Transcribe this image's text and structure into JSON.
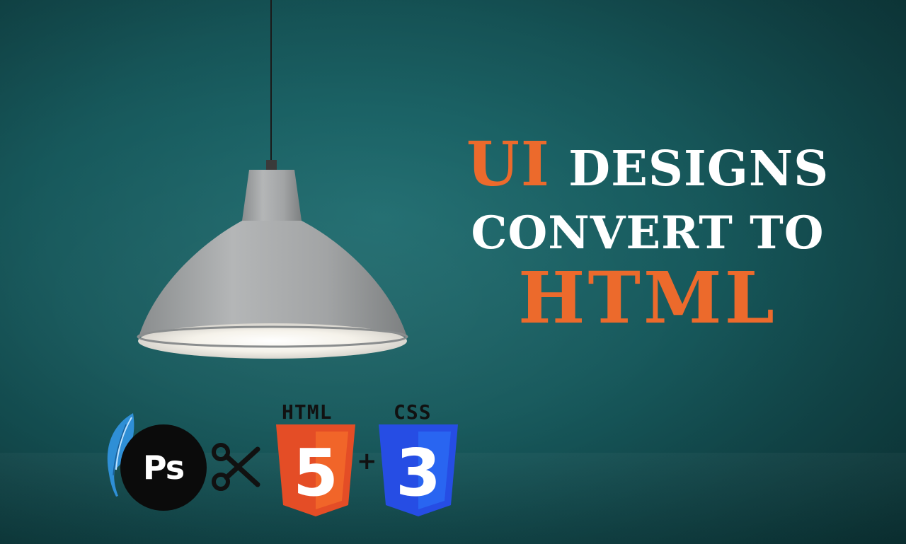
{
  "headline": {
    "ui": "UI",
    "designs": "DESIGNS",
    "convert_to": "CONVERT TO",
    "html": "HTML"
  },
  "logos": {
    "ps_text": "Ps",
    "html_label": "HTML",
    "html_number": "5",
    "plus": "+",
    "css_label": "CSS",
    "css_number": "3"
  },
  "colors": {
    "background": "#17595c",
    "accent_orange": "#ec6a2c",
    "headline_white": "#ffffff",
    "html5_orange": "#e44d26",
    "css3_blue": "#264de4",
    "ps_black": "#0b0b0b",
    "lamp_gray": "#a7a9aa"
  },
  "icons": [
    "feather-icon",
    "photoshop-icon",
    "scissors-icon",
    "html5-shield-icon",
    "css3-shield-icon",
    "pendant-lamp"
  ]
}
